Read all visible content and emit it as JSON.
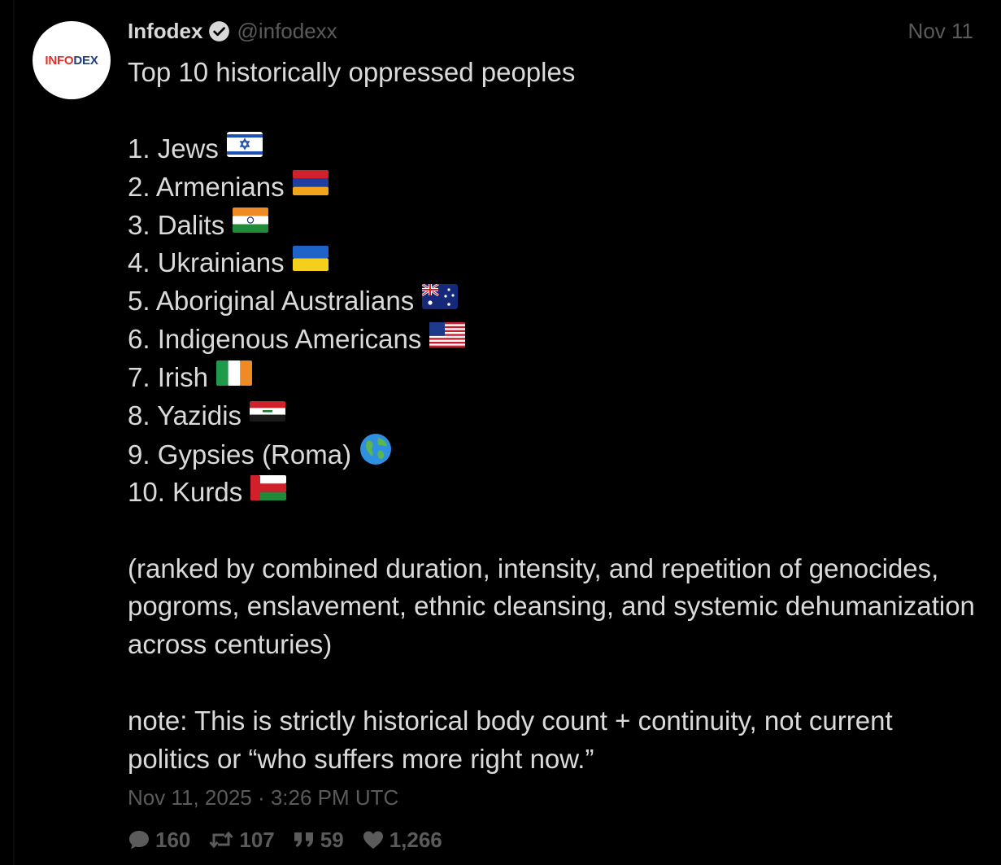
{
  "author": {
    "display_name": "Infodex",
    "handle": "@infodexx",
    "verified": true,
    "avatar_text_a": "INFO",
    "avatar_text_b": "DEX"
  },
  "date_short": "Nov 11",
  "tweet": {
    "title": "Top 10 historically oppressed peoples",
    "items": [
      {
        "text": "1. Jews",
        "flag": "israel-flag"
      },
      {
        "text": "2. Armenians",
        "flag": "armenia-flag"
      },
      {
        "text": "3. Dalits",
        "flag": "india-flag"
      },
      {
        "text": "4. Ukrainians",
        "flag": "ukraine-flag"
      },
      {
        "text": "5. Aboriginal Australians",
        "flag": "australia-flag"
      },
      {
        "text": "6. Indigenous Americans",
        "flag": "usa-flag"
      },
      {
        "text": "7. Irish",
        "flag": "ireland-flag"
      },
      {
        "text": "8. Yazidis",
        "flag": "iraq-flag"
      },
      {
        "text": "9. Gypsies (Roma)",
        "flag": "globe-icon"
      },
      {
        "text": "10. Kurds",
        "flag": "oman-flag"
      }
    ],
    "ranking_note": "(ranked by combined duration, intensity, and repetition of genocides, pogroms, enslavement, ethnic cleansing, and systemic dehumanization across centuries)",
    "note": "note: This is strictly historical body count + continuity, not current politics or “who suffers more right now.”"
  },
  "timestamp": "Nov 11, 2025 · 3:26 PM UTC",
  "stats": {
    "replies": "160",
    "retweets": "107",
    "quotes": "59",
    "likes": "1,266"
  },
  "colors": {
    "background": "#000000",
    "text": "#dadada",
    "muted": "#5b5b5b"
  }
}
